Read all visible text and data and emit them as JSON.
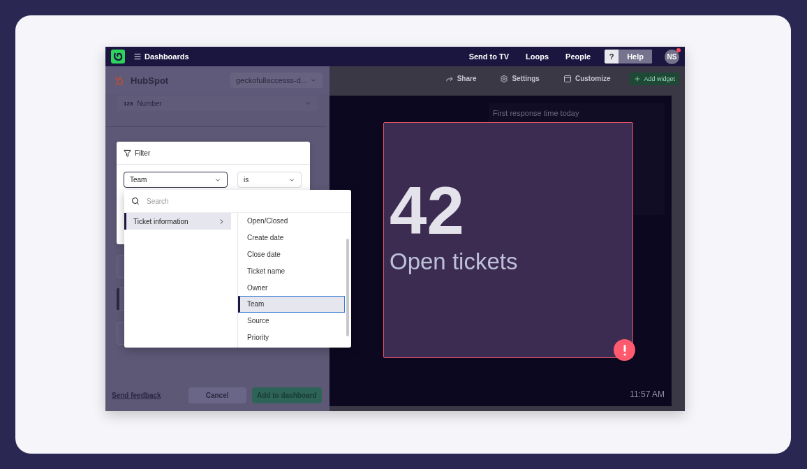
{
  "topbar": {
    "title": "Dashboards",
    "nav": [
      "Send to TV",
      "Loops",
      "People"
    ],
    "help": {
      "icon_label": "?",
      "label": "Help"
    },
    "avatar": {
      "initials": "NS",
      "notification": true
    }
  },
  "source": {
    "name": "HubSpot",
    "account": "geckofullaccesss-d..."
  },
  "visualization": {
    "icon_label": "123",
    "label": "Number"
  },
  "filter": {
    "title": "Filter",
    "field": "Team",
    "operator": "is"
  },
  "dropdown": {
    "search_placeholder": "Search",
    "categories": [
      {
        "label": "Ticket information",
        "selected": true
      }
    ],
    "options": [
      {
        "label": "Open/Closed",
        "selected": false
      },
      {
        "label": "Create date",
        "selected": false
      },
      {
        "label": "Close date",
        "selected": false
      },
      {
        "label": "Ticket name",
        "selected": false
      },
      {
        "label": "Owner",
        "selected": false
      },
      {
        "label": "Team",
        "selected": true
      },
      {
        "label": "Source",
        "selected": false
      },
      {
        "label": "Priority",
        "selected": false
      }
    ]
  },
  "footer": {
    "link": "Send feedback",
    "cancel": "Cancel",
    "submit": "Add to dashboard"
  },
  "toolbar": [
    {
      "kind": "share",
      "label": "Share"
    },
    {
      "kind": "settings",
      "label": "Settings"
    },
    {
      "kind": "customize",
      "label": "Customize"
    }
  ],
  "add_widget": "Add widget",
  "widgets": [
    {
      "title": "First response time today"
    }
  ],
  "number_widget": {
    "value": "42",
    "label": "Open tickets",
    "alert": true
  },
  "clock": "11:57 AM"
}
